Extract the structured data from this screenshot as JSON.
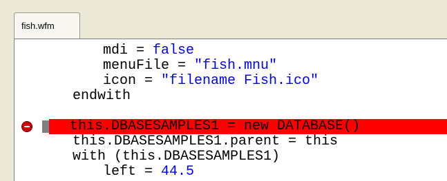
{
  "tab": {
    "label": "fish.wfm"
  },
  "code": {
    "line1_a": "mdi = ",
    "line1_b": "false",
    "line2_a": "menuFile = ",
    "line2_b": "\"fish.mnu\"",
    "line3_a": "icon = ",
    "line3_b": "\"filename Fish.ico\"",
    "line4": "endwith",
    "line5_blank": "",
    "line6": "this.DBASESAMPLES1 = new DATABASE()",
    "line7": "this.DBASESAMPLES1.parent = this",
    "line8": "with (this.DBASESAMPLES1)",
    "line9_a": "left = ",
    "line9_b": "44.5"
  },
  "colors": {
    "keyword": "#0000ff",
    "breakpoint_line": "#ff0000",
    "editor_bg": "#ffffff",
    "frame_bg": "#ece9d8"
  },
  "icons": {
    "breakpoint": "breakpoint-icon",
    "gutter_marker": "gutter-marker"
  }
}
